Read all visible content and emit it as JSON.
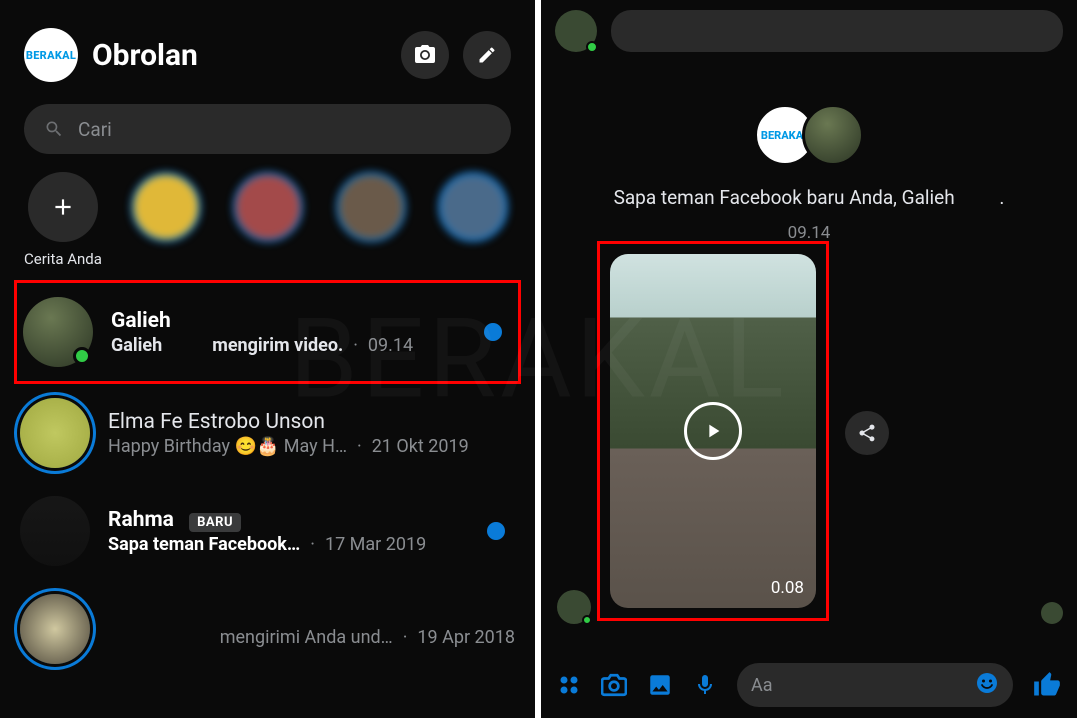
{
  "brand": "BERAKAL",
  "watermark": "BERAKAL",
  "left": {
    "title": "Obrolan",
    "search_placeholder": "Cari",
    "your_story": "Cerita Anda",
    "chats": [
      {
        "name": "Galieh",
        "preview_name": "Galieh",
        "preview_action": "mengirim video.",
        "timestamp": "09.14",
        "unread": true,
        "online": true,
        "highlighted": true
      },
      {
        "name": "Elma Fe Estrobo Unson",
        "preview": "Happy Birthday 😊🎂 May H…",
        "timestamp": "21 Okt 2019",
        "unread": false,
        "ring": true
      },
      {
        "name": "Rahma",
        "badge": "BARU",
        "preview": "Sapa teman Facebook…",
        "timestamp": "17 Mar 2019",
        "unread": true
      },
      {
        "preview": "mengirimi Anda und…",
        "timestamp": "19 Apr 2018",
        "unread": false,
        "ring": true
      }
    ]
  },
  "right": {
    "intro": "Sapa teman Facebook baru Anda, Galieh",
    "intro_dot": ".",
    "intro_time": "09.14",
    "video_duration": "0.08",
    "composer_placeholder": "Aa"
  }
}
